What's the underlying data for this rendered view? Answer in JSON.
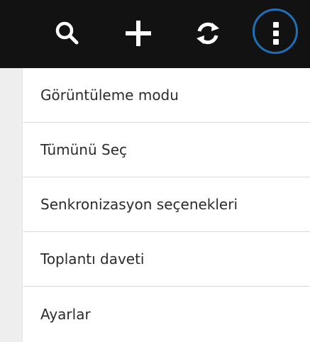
{
  "toolbar": {
    "actions": [
      {
        "icon": "search-icon"
      },
      {
        "icon": "plus-icon"
      },
      {
        "icon": "sync-icon"
      },
      {
        "icon": "overflow-menu-icon"
      }
    ],
    "background": "#121212",
    "highlight_color": "#1e6fb8"
  },
  "menu": {
    "items": [
      {
        "label": "Görüntüleme modu"
      },
      {
        "label": "Tümünü Seç"
      },
      {
        "label": "Senkronizasyon seçenekleri"
      },
      {
        "label": "Toplantı daveti"
      },
      {
        "label": "Ayarlar"
      }
    ]
  }
}
